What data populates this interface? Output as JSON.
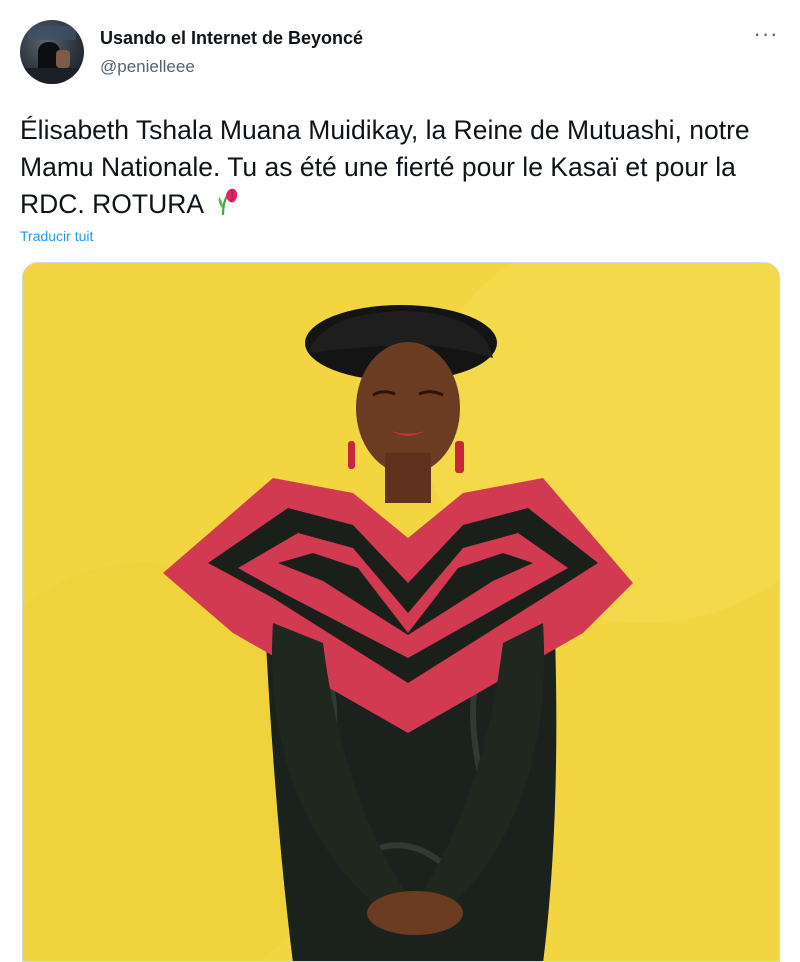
{
  "author": {
    "display_name": "Usando el Internet de Beyoncé",
    "handle": "@penielleee",
    "avatar_icon": "profile-photo"
  },
  "menu": {
    "more_label": "···",
    "icon": "more-options-icon"
  },
  "tweet": {
    "text": "Élisabeth Tshala Muana Muidikay, la Reine de Mutuashi, notre Mamu Nationale. Tu as été une fierté pour le Kasaï et pour la RDC. ROTURA",
    "emoji": "wilted-flower-icon",
    "translate_label": "Traducir tuit"
  },
  "media": {
    "type": "photo",
    "background_color": "#f2d541"
  },
  "colors": {
    "text": "#0f1419",
    "secondary": "#536471",
    "link": "#1d9bf0"
  }
}
